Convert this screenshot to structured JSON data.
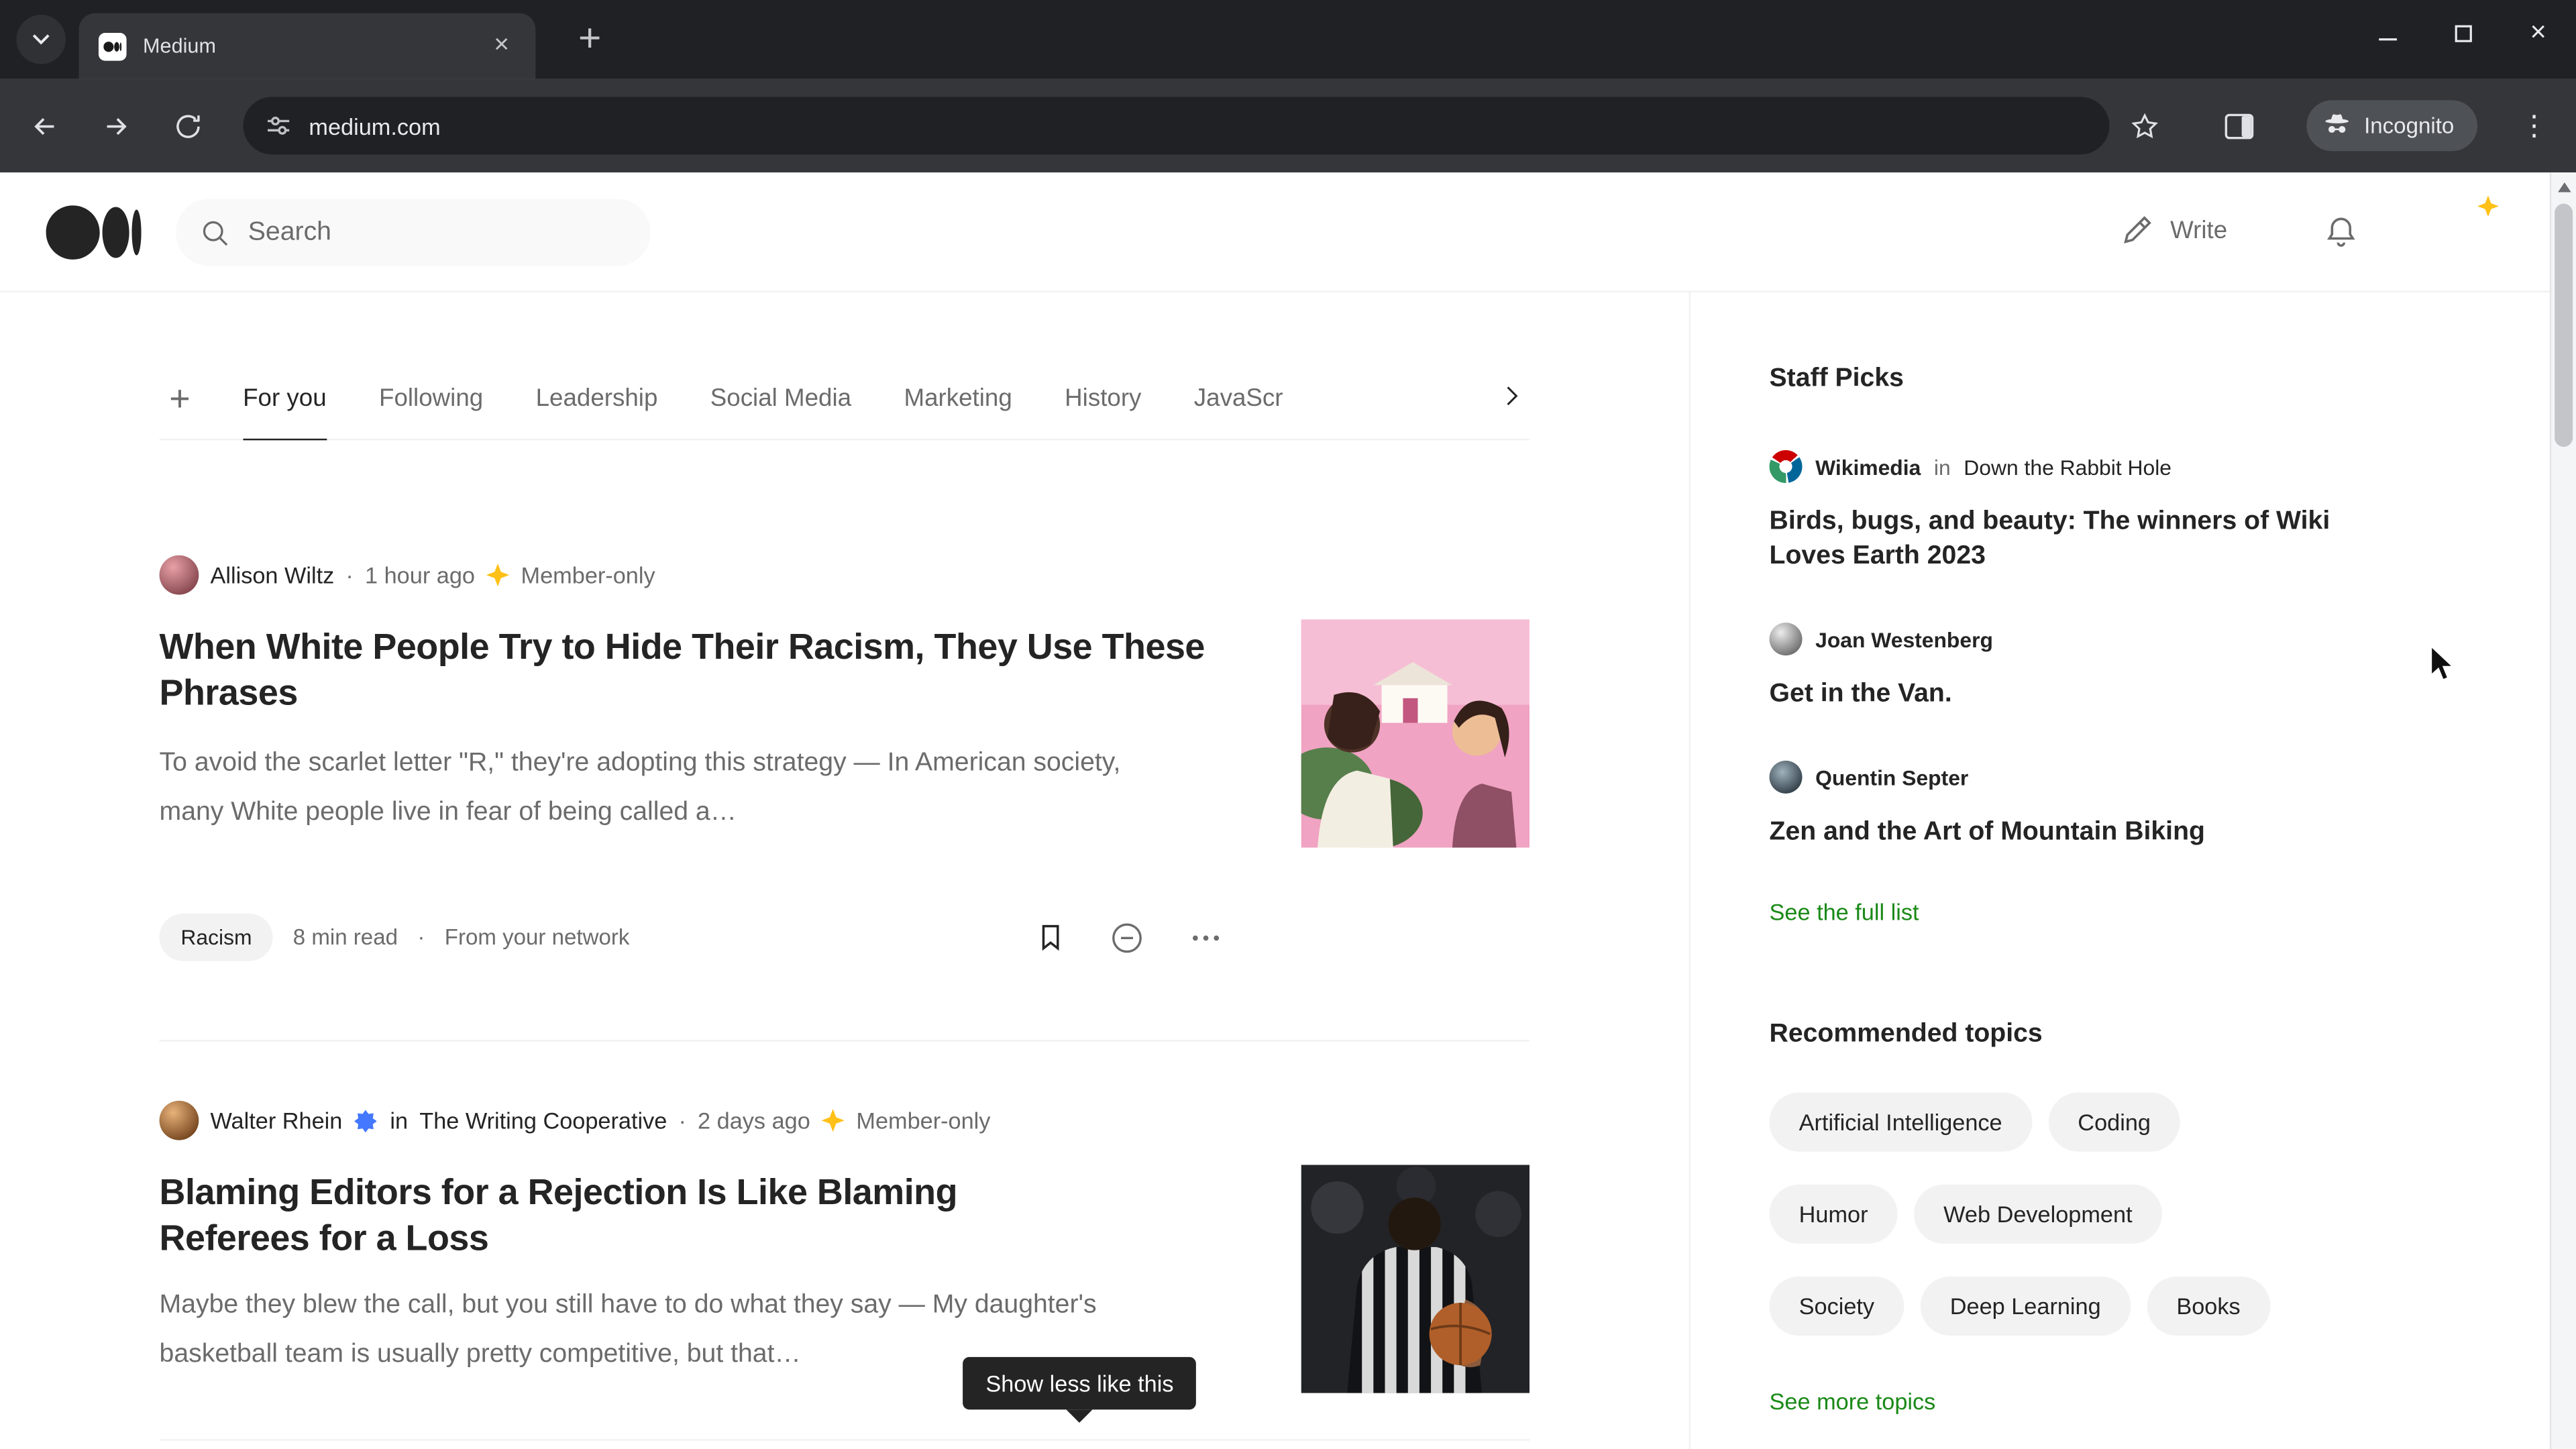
{
  "ui": {
    "dot": "·",
    "plus": "+"
  },
  "browser": {
    "tab_title": "Medium",
    "url": "medium.com",
    "incognito_label": "Incognito"
  },
  "header": {
    "search_placeholder": "Search",
    "write_label": "Write"
  },
  "feed_tabs": {
    "labels": [
      "For you",
      "Following",
      "Leadership",
      "Social Media",
      "Marketing",
      "History",
      "JavaScript"
    ],
    "active": "For you"
  },
  "articles": [
    {
      "author": "Allison Wiltz",
      "time": "1 hour ago",
      "badge": "Member-only",
      "title": "When White People Try to Hide Their Racism, They Use These Phrases",
      "excerpt": "To avoid the scarlet letter \"R,\" they're adopting this strategy — In American society, many White people live in fear of being called a…",
      "tag": "Racism",
      "read_time": "8 min read",
      "source": "From your network"
    },
    {
      "author": "Walter Rhein",
      "in_word": "in",
      "publication": "The Writing Cooperative",
      "time": "2 days ago",
      "badge": "Member-only",
      "title": "Blaming Editors for a Rejection Is Like Blaming Referees for a Loss",
      "excerpt": "Maybe they blew the call, but you still have to do what they say — My daughter's basketball team is usually pretty competitive, but that…"
    }
  ],
  "tooltip": {
    "label": "Show less like this"
  },
  "staff_picks": {
    "title": "Staff Picks",
    "items": [
      {
        "author": "Wikimedia",
        "in_word": "in",
        "publication": "Down the Rabbit Hole",
        "title": "Birds, bugs, and beauty: The winners of Wiki Loves Earth 2023"
      },
      {
        "author": "Joan Westenberg",
        "title": "Get in the Van."
      },
      {
        "author": "Quentin Septer",
        "title": "Zen and the Art of Mountain Biking"
      }
    ],
    "see_full_list": "See the full list"
  },
  "topics": {
    "title": "Recommended topics",
    "rows": [
      [
        "Artificial Intelligence",
        "Coding"
      ],
      [
        "Humor",
        "Web Development"
      ],
      [
        "Society",
        "Deep Learning",
        "Books"
      ]
    ],
    "see_more": "See more topics"
  },
  "colors": {
    "accent_green": "#1a8917",
    "member_gold": "#ffc017",
    "verified_blue": "#4378ff",
    "text_primary": "#242424",
    "text_secondary": "#6b6b6b"
  }
}
